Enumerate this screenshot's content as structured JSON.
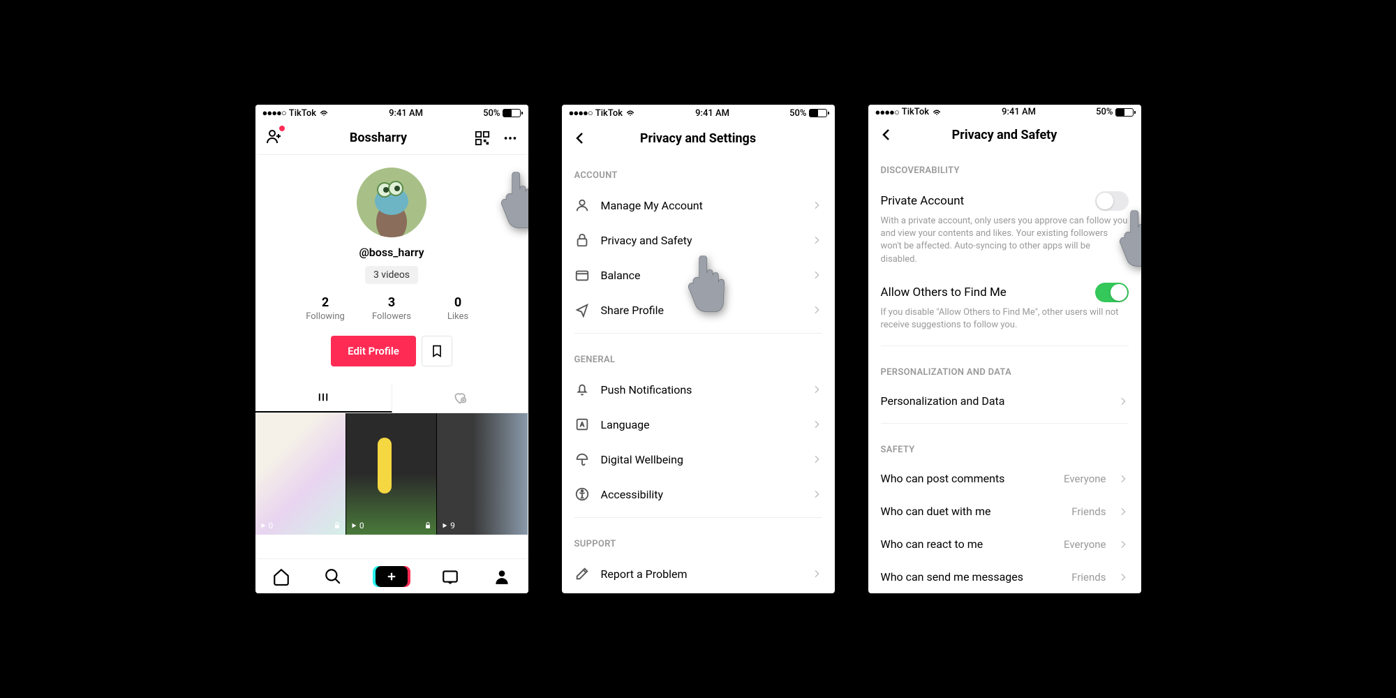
{
  "status": {
    "carrier": "TikTok",
    "time": "9:41 AM",
    "battery_pct": "50%"
  },
  "screen1": {
    "title": "Bossharry",
    "username": "@boss_harry",
    "video_count": "3 videos",
    "stats": {
      "following_n": "2",
      "following_l": "Following",
      "followers_n": "3",
      "followers_l": "Followers",
      "likes_n": "0",
      "likes_l": "Likes"
    },
    "edit_btn": "Edit Profile",
    "grid": [
      {
        "count": "0"
      },
      {
        "count": "0"
      },
      {
        "count": "9"
      }
    ]
  },
  "screen2": {
    "title": "Privacy and Settings",
    "sections": {
      "account_header": "ACCOUNT",
      "account": [
        {
          "label": "Manage My Account"
        },
        {
          "label": "Privacy and Safety"
        },
        {
          "label": "Balance"
        },
        {
          "label": "Share Profile"
        }
      ],
      "general_header": "GENERAL",
      "general": [
        {
          "label": "Push Notifications"
        },
        {
          "label": "Language"
        },
        {
          "label": "Digital Wellbeing"
        },
        {
          "label": "Accessibility"
        }
      ],
      "support_header": "SUPPORT",
      "support": [
        {
          "label": "Report a Problem"
        }
      ]
    }
  },
  "screen3": {
    "title": "Privacy and Safety",
    "discoverability_header": "DISCOVERABILITY",
    "private": {
      "label": "Private Account",
      "desc": "With a private account, only users you approve can follow you and view your contents and likes. Your existing followers won't be affected. Auto-syncing to other apps will be disabled."
    },
    "findme": {
      "label": "Allow Others to Find Me",
      "desc": "If you disable \"Allow Others to Find Me\", other users will not receive suggestions to follow you."
    },
    "personalization_header": "PERSONALIZATION AND DATA",
    "personalization_label": "Personalization and Data",
    "safety_header": "SAFETY",
    "safety": [
      {
        "label": "Who can post comments",
        "value": "Everyone"
      },
      {
        "label": "Who can duet with me",
        "value": "Friends"
      },
      {
        "label": "Who can react to me",
        "value": "Everyone"
      },
      {
        "label": "Who can send me messages",
        "value": "Friends"
      }
    ]
  }
}
